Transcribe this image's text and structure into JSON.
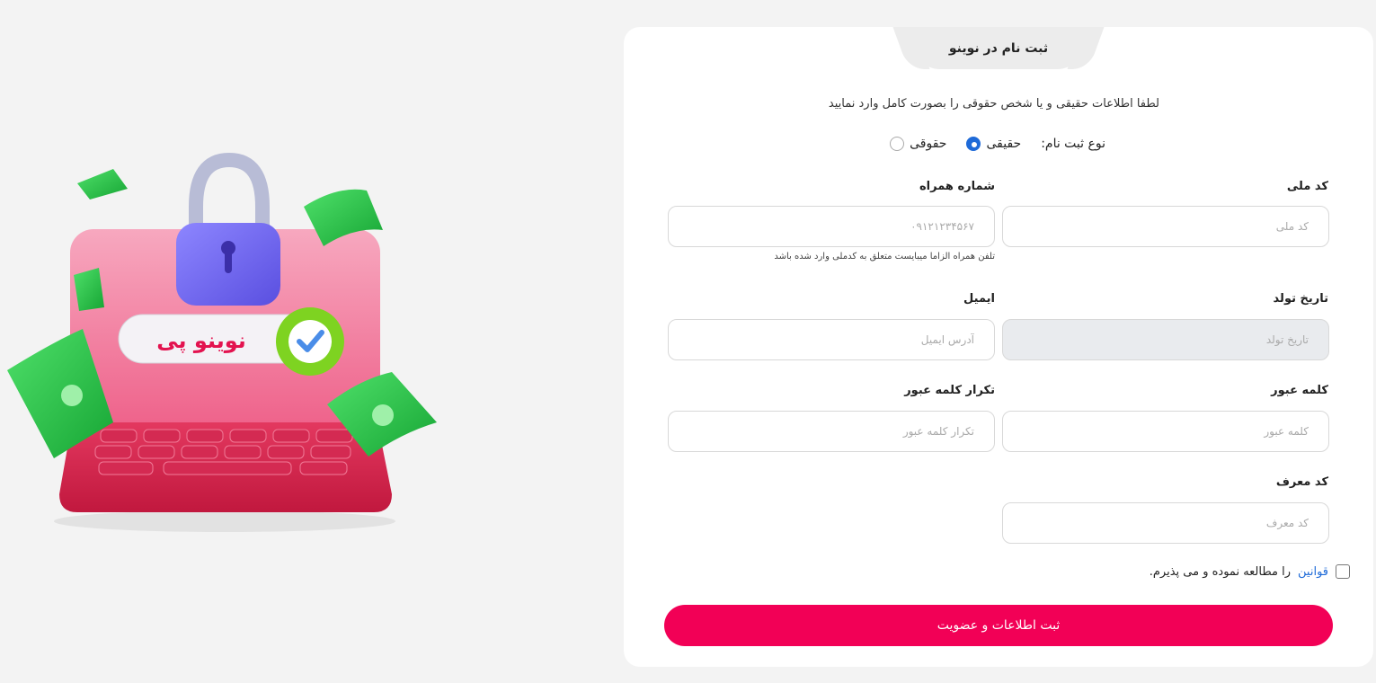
{
  "header": {
    "title": "ثبت نام در نوینو"
  },
  "intro_text": "لطفا اطلاعات حقیقی و یا شخص حقوقی را بصورت کامل وارد نمایید",
  "registration_type": {
    "label": "نوع ثبت نام:",
    "options": [
      {
        "label": "حقیقی",
        "selected": true
      },
      {
        "label": "حقوقی",
        "selected": false
      }
    ]
  },
  "fields": {
    "national_code": {
      "label": "کد ملی",
      "placeholder": "کد ملی",
      "value": ""
    },
    "mobile": {
      "label": "شماره همراه",
      "placeholder": "۰۹۱۲۱۲۳۴۵۶۷",
      "value": "",
      "hint": "تلفن همراه الزاما میبایست متعلق به کدملی وارد شده باشد"
    },
    "birth_date": {
      "label": "تاریخ تولد",
      "placeholder": "تاریخ تولد",
      "value": "",
      "disabled": true
    },
    "email": {
      "label": "ایمیل",
      "placeholder": "آدرس ایمیل",
      "value": ""
    },
    "password": {
      "label": "کلمه عبور",
      "placeholder": "کلمه عبور",
      "value": ""
    },
    "password_repeat": {
      "label": "تکرار کلمه عبور",
      "placeholder": "تکرار کلمه عبور",
      "value": ""
    },
    "referral_code": {
      "label": "کد معرف",
      "placeholder": "کد معرف",
      "value": ""
    }
  },
  "terms": {
    "link_text": "قوانین",
    "rest_text": "را مطالعه نموده و می پذیرم.",
    "checked": false
  },
  "submit": {
    "label": "ثبت اطلاعات و عضویت"
  },
  "illustration": {
    "logo_text": "نوینو پی"
  },
  "colors": {
    "accent": "#f20056",
    "link": "#1e6ad8",
    "page_bg": "#f3f3f3",
    "card_bg": "#ffffff",
    "disabled_bg": "#e9ebee"
  }
}
